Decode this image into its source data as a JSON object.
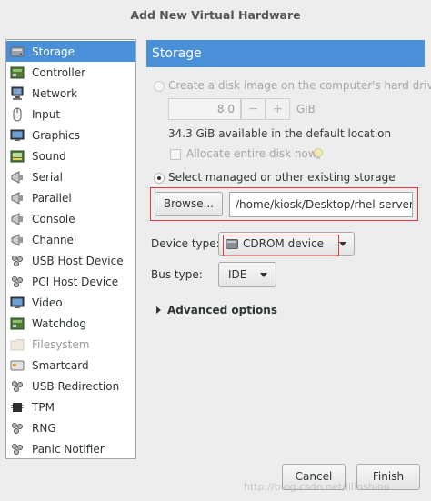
{
  "window": {
    "title": "Add New Virtual Hardware"
  },
  "sidebar": {
    "items": [
      {
        "label": "Storage",
        "icon": "hard-disk-icon",
        "selected": true,
        "disabled": false
      },
      {
        "label": "Controller",
        "icon": "controller-icon",
        "selected": false,
        "disabled": false
      },
      {
        "label": "Network",
        "icon": "network-icon",
        "selected": false,
        "disabled": false
      },
      {
        "label": "Input",
        "icon": "mouse-icon",
        "selected": false,
        "disabled": false
      },
      {
        "label": "Graphics",
        "icon": "monitor-icon",
        "selected": false,
        "disabled": false
      },
      {
        "label": "Sound",
        "icon": "sound-card-icon",
        "selected": false,
        "disabled": false
      },
      {
        "label": "Serial",
        "icon": "serial-icon",
        "selected": false,
        "disabled": false
      },
      {
        "label": "Parallel",
        "icon": "parallel-icon",
        "selected": false,
        "disabled": false
      },
      {
        "label": "Console",
        "icon": "console-icon",
        "selected": false,
        "disabled": false
      },
      {
        "label": "Channel",
        "icon": "channel-icon",
        "selected": false,
        "disabled": false
      },
      {
        "label": "USB Host Device",
        "icon": "usb-icon",
        "selected": false,
        "disabled": false
      },
      {
        "label": "PCI Host Device",
        "icon": "pci-icon",
        "selected": false,
        "disabled": false
      },
      {
        "label": "Video",
        "icon": "video-icon",
        "selected": false,
        "disabled": false
      },
      {
        "label": "Watchdog",
        "icon": "watchdog-icon",
        "selected": false,
        "disabled": false
      },
      {
        "label": "Filesystem",
        "icon": "folder-icon",
        "selected": false,
        "disabled": true
      },
      {
        "label": "Smartcard",
        "icon": "smartcard-icon",
        "selected": false,
        "disabled": false
      },
      {
        "label": "USB Redirection",
        "icon": "usb-redirection-icon",
        "selected": false,
        "disabled": false
      },
      {
        "label": "TPM",
        "icon": "tpm-chip-icon",
        "selected": false,
        "disabled": false
      },
      {
        "label": "RNG",
        "icon": "rng-icon",
        "selected": false,
        "disabled": false
      },
      {
        "label": "Panic Notifier",
        "icon": "panic-icon",
        "selected": false,
        "disabled": false
      }
    ]
  },
  "panel": {
    "title": "Storage",
    "create_option_label": "Create a disk image on the computer's hard drive",
    "disk_size_value": "8.0",
    "minus": "−",
    "plus": "+",
    "size_unit": "GiB",
    "available_text": "34.3 GiB available in the default location",
    "allocate_label": "Allocate entire disk now",
    "managed_option_label": "Select managed or other existing storage",
    "browse_label": "Browse...",
    "path_value": "/home/kiosk/Desktop/rhel-server-",
    "device_type_label": "Device type:",
    "device_type_value": "CDROM device",
    "bus_type_label": "Bus type:",
    "bus_type_value": "IDE",
    "advanced_label": "Advanced options"
  },
  "buttons": {
    "cancel": "Cancel",
    "finish": "Finish"
  },
  "watermark": "http://blog.csdn.net/lilinshiou",
  "colors": {
    "accent": "#4a90d9",
    "highlight_border": "#e23a3a"
  }
}
